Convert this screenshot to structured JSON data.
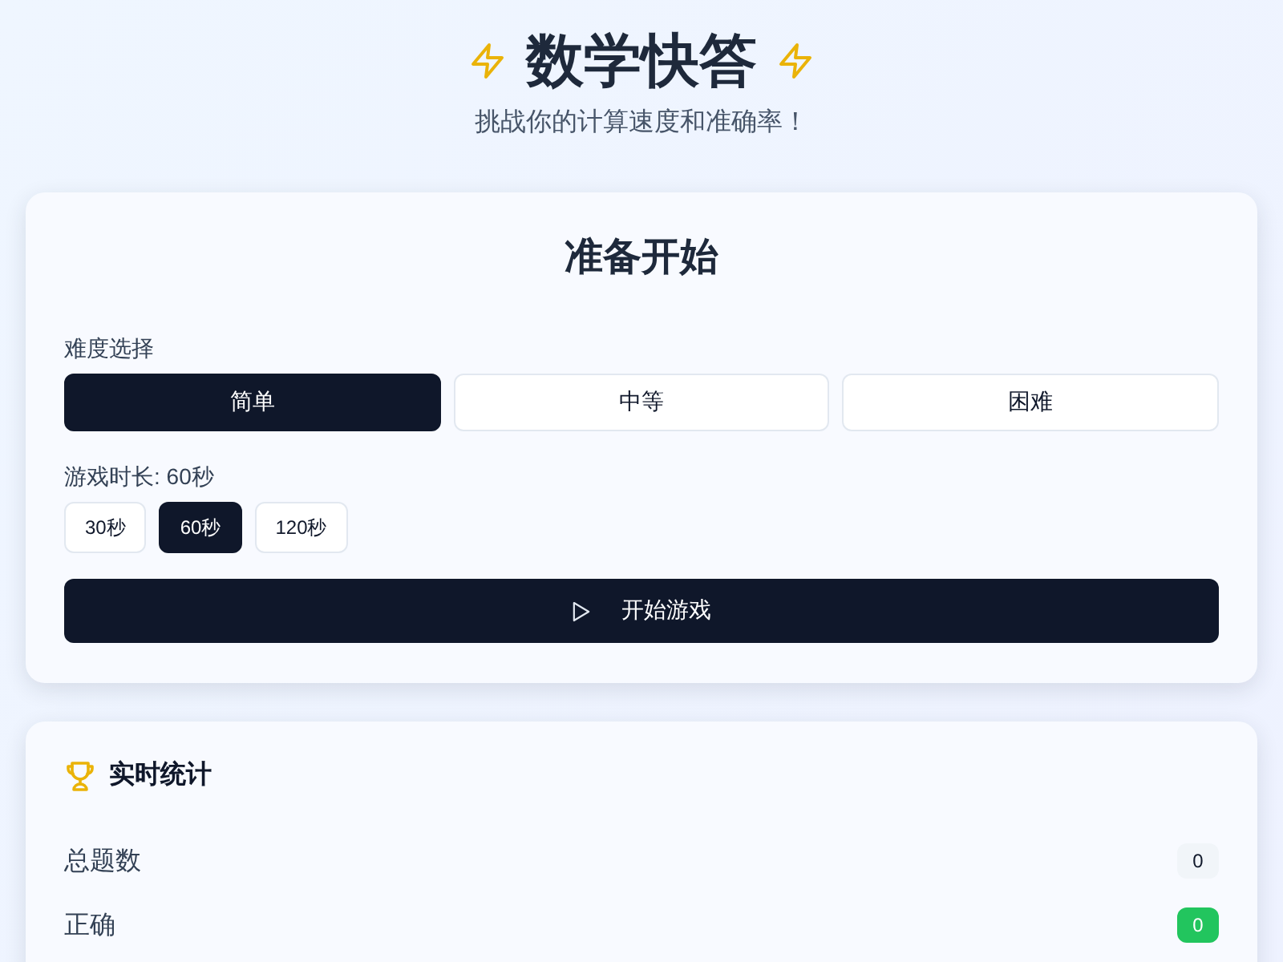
{
  "header": {
    "title": "数学快答",
    "subtitle": "挑战你的计算速度和准确率！"
  },
  "setup": {
    "title": "准备开始",
    "difficulty_label": "难度选择",
    "difficulties": [
      {
        "label": "简单",
        "selected": true
      },
      {
        "label": "中等",
        "selected": false
      },
      {
        "label": "困难",
        "selected": false
      }
    ],
    "duration_label": "游戏时长: 60秒",
    "durations": [
      {
        "label": "30秒",
        "selected": false
      },
      {
        "label": "60秒",
        "selected": true
      },
      {
        "label": "120秒",
        "selected": false
      }
    ],
    "start_button": "开始游戏"
  },
  "stats": {
    "title": "实时统计",
    "rows": [
      {
        "label": "总题数",
        "value": "0",
        "kind": "neutral"
      },
      {
        "label": "正确",
        "value": "0",
        "kind": "correct"
      }
    ]
  }
}
